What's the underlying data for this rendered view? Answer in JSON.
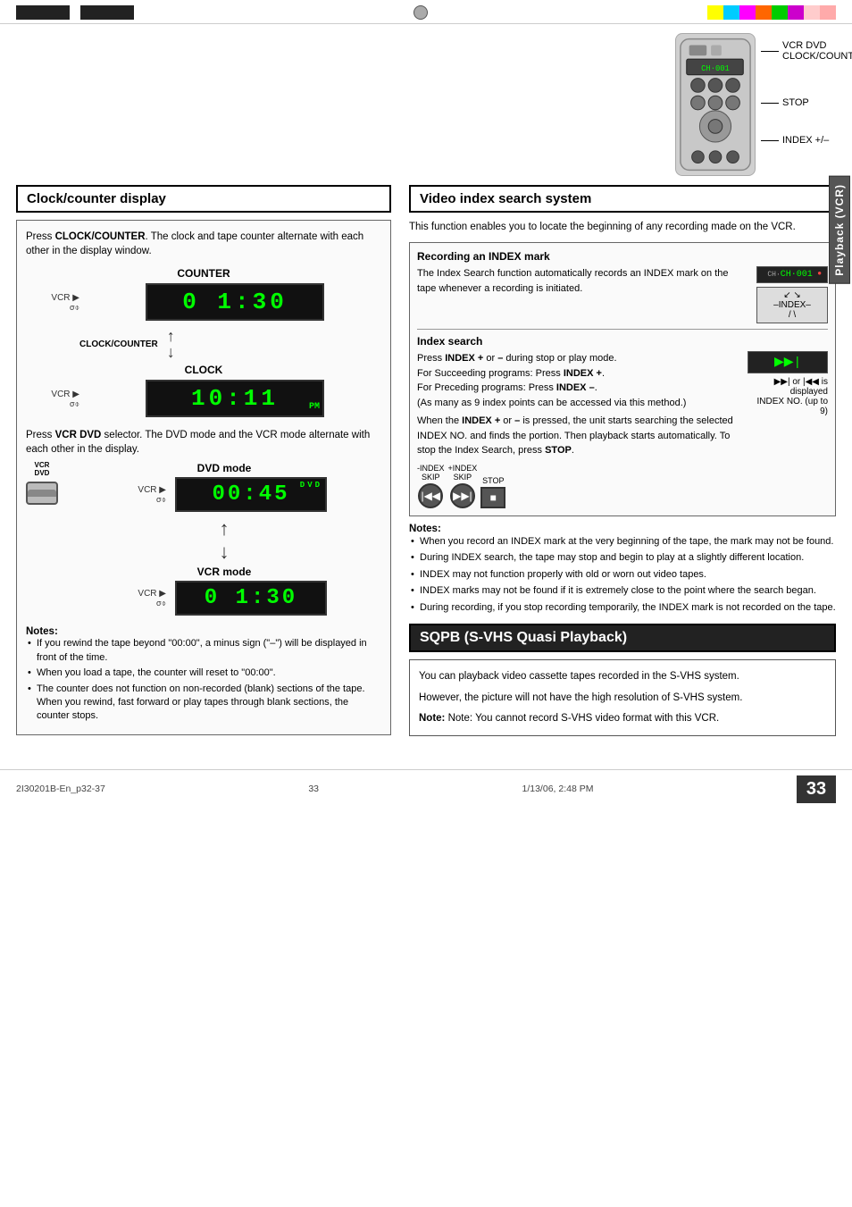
{
  "topBar": {
    "colorBlocks": [
      "#000",
      "#000",
      "#000"
    ],
    "colors": [
      "#ffff00",
      "#00ccff",
      "#ff00ff",
      "#ff6600",
      "#00cc00",
      "#cc00cc",
      "#ffcccc",
      "#ffaaaa"
    ]
  },
  "remote": {
    "labels": {
      "vcr_dvd": "VCR DVD\nCLOCK/COUNTER",
      "stop": "STOP",
      "index": "INDEX +/–"
    }
  },
  "clockCounter": {
    "header": "Clock/counter display",
    "intro": "Press CLOCK/COUNTER. The clock and tape counter alternate with each other in the display window.",
    "counter_label": "COUNTER",
    "counter_display": "0 1:30",
    "clock_label": "CLOCK",
    "clock_display": "10:11",
    "clock_display_pm": "PM",
    "clock_counter_left": "CLOCK/COUNTER",
    "vcr_text": "Press VCR DVD selector. The DVD mode and the VCR mode alternate with each other in the display.",
    "dvd_mode_label": "DVD mode",
    "dvd_display": "00:45",
    "dvd_suffix": "DVD",
    "vcr_mode_label": "VCR mode",
    "vcr_display": "0 1:30",
    "vcr_label": "VCR\nDVD",
    "notes_title": "Notes:",
    "notes": [
      "If you rewind the tape beyond \"00:00\", a minus sign (\"–\") will be displayed in front of the time.",
      "When you load a tape, the counter will reset to \"00:00\".",
      "The counter does not function on non-recorded (blank) sections of the tape. When you rewind, fast forward or play tapes through blank sections, the counter stops."
    ]
  },
  "videoIndex": {
    "header": "Video index search system",
    "intro": "This function enables you to locate the beginning of any recording made on the VCR.",
    "recording_title": "Recording an INDEX mark",
    "recording_text": "The Index Search function automatically records an INDEX mark on the tape whenever a recording is initiated.",
    "ch_display": "CH·001",
    "index_symbol": "–INDEX–\n/ \\",
    "index_search_title": "Index search",
    "index_search_lines": [
      "Press INDEX + or – during stop or play mode.",
      "For Succeeding programs: Press INDEX +.",
      "For Preceding programs: Press INDEX –.",
      "(As many as 9 index points can be accessed via this method.)",
      "When the INDEX + or – is pressed, the unit starts searching the selected INDEX NO. and finds the portion. Then playback starts automatically. To stop the Index Search, press STOP."
    ],
    "ff_display": "▶▶|",
    "ff_legend": "▶▶| or |◀◀ is displayed",
    "index_no_legend": "INDEX NO. (up to 9)",
    "btn_minus_index_label": "-INDEX\nSKIP",
    "btn_plus_index_label": "+INDEX\nSKIP",
    "btn_stop_label": "STOP",
    "notes_title": "Notes:",
    "notes": [
      "When you record an INDEX mark at the very beginning of the tape, the mark may not be found.",
      "During INDEX search, the tape may stop and begin to play at a slightly different location.",
      "INDEX may not function properly with old or worn out video tapes.",
      "INDEX marks may not be found if it is extremely close to the point where the search began.",
      "During recording, if you stop recording temporarily, the INDEX mark is not recorded on the tape."
    ]
  },
  "sqpb": {
    "header": "SQPB (S-VHS Quasi Playback)",
    "text1": "You can playback video cassette tapes recorded in the S-VHS system.",
    "text2": "However, the picture will not have the high resolution of S-VHS system.",
    "note": "Note: You cannot record S-VHS video format with this VCR."
  },
  "sideTab": "Playback (VCR)",
  "bottomBar": {
    "left": "2I30201B-En_p32-37",
    "center": "33",
    "right": "1/13/06, 2:48 PM",
    "pageNumber": "33"
  }
}
